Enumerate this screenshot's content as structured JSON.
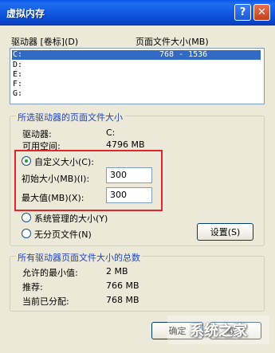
{
  "window": {
    "title": "虚拟内存",
    "help_label": "?",
    "close_label": "✕"
  },
  "columns": {
    "drive": "驱动器 [卷标](D)",
    "pagefile": "页面文件大小(MB)"
  },
  "drives": [
    {
      "drive": "C:",
      "size": "768 - 1536",
      "selected": true
    },
    {
      "drive": "D:",
      "size": "",
      "selected": false
    },
    {
      "drive": "E:",
      "size": "",
      "selected": false
    },
    {
      "drive": "F:",
      "size": "",
      "selected": false
    },
    {
      "drive": "G:",
      "size": "",
      "selected": false
    }
  ],
  "selected_group": {
    "legend": "所选驱动器的页面文件大小",
    "drive_label": "驱动器:",
    "drive_value": "C:",
    "space_label": "可用空间:",
    "space_value": "4796 MB",
    "custom_label": "自定义大小(C):",
    "initial_label": "初始大小(MB)(I):",
    "initial_value": "300",
    "max_label": "最大值(MB)(X):",
    "max_value": "300",
    "system_label": "系统管理的大小(Y)",
    "nofile_label": "无分页文件(N)",
    "set_button": "设置(S)"
  },
  "total_group": {
    "legend": "所有驱动器页面文件大小的总数",
    "min_label": "允许的最小值:",
    "min_value": "2 MB",
    "rec_label": "推荐:",
    "rec_value": "766 MB",
    "cur_label": "当前已分配:",
    "cur_value": "768 MB"
  },
  "footer": {
    "ok": "确定",
    "cancel": "取消"
  },
  "watermark": {
    "text": "系统之家"
  }
}
